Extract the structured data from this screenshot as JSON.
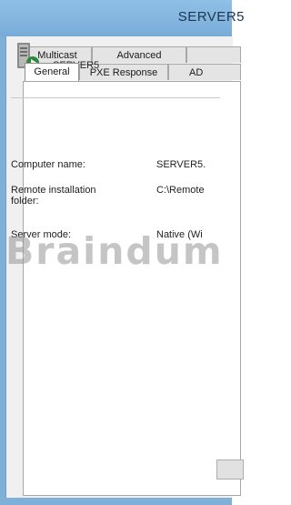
{
  "window": {
    "title": "SERVER5"
  },
  "tabs": {
    "back_row": [
      {
        "label": "Multicast"
      },
      {
        "label": "Advanced"
      },
      {
        "label": ""
      }
    ],
    "front_row": [
      {
        "label": "General",
        "active": true
      },
      {
        "label": "PXE Response"
      },
      {
        "label": "AD"
      }
    ]
  },
  "general": {
    "server_icon": "server-play-icon",
    "server_name": "SERVER5",
    "fields": [
      {
        "label": "Computer name:",
        "value": "SERVER5."
      },
      {
        "label": "Remote installation folder:",
        "value": "C:\\Remote"
      },
      {
        "label": "Server mode:",
        "value": "Native (Wi"
      }
    ]
  },
  "watermark": {
    "text": "Braindum"
  },
  "colors": {
    "window_frame": "#7fb0d8",
    "dialog_background": "#f0f0f0",
    "panel_background": "#ffffff"
  }
}
